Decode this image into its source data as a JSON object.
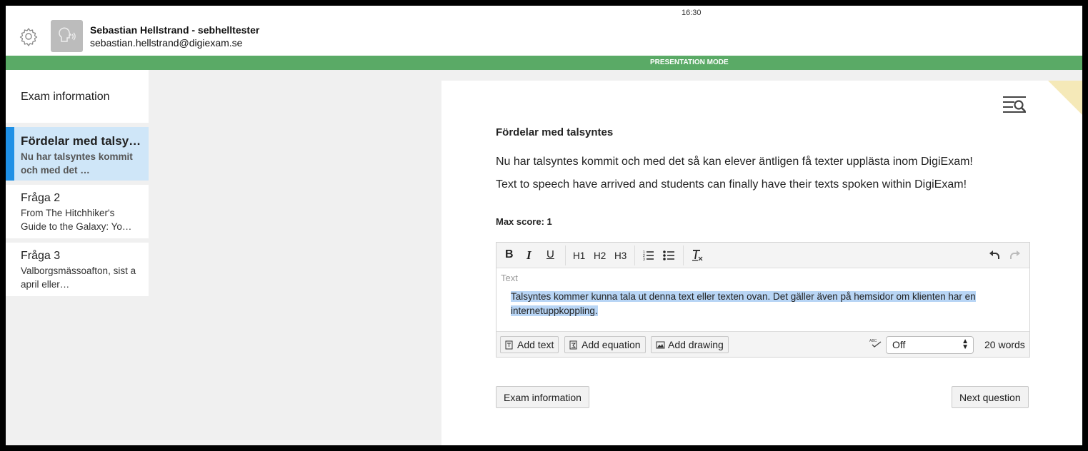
{
  "status": {
    "time": "16:30"
  },
  "user": {
    "name": "Sebastian Hellstrand - sebhelltester",
    "email": "sebastian.hellstrand@digiexam.se"
  },
  "mode_banner": "PRESENTATION MODE",
  "sidebar": {
    "info_label": "Exam information",
    "items": [
      {
        "title": "Fördelar med talsy…",
        "subtitle": "Nu har talsyntes kommit och med det …",
        "active": true
      },
      {
        "title": "Fråga 2",
        "subtitle": "From The Hitchhiker's Guide to the Galaxy: Yo…",
        "active": false
      },
      {
        "title": "Fråga 3",
        "subtitle": "Valborgsmässoafton, sist a april eller…",
        "active": false
      }
    ]
  },
  "question": {
    "title": "Fördelar med talsyntes",
    "line1": "Nu har talsyntes kommit och med det så kan elever äntligen få texter upplästa inom DigiExam!",
    "line2": "Text to speech have arrived and students can finally have their texts spoken within DigiExam!",
    "max_score": "Max score: 1"
  },
  "editor": {
    "toolbar": {
      "bold": "B",
      "italic": "I",
      "underline": "U",
      "h1": "H1",
      "h2": "H2",
      "h3": "H3"
    },
    "placeholder": "Text",
    "answer": "Talsyntes kommer kunna tala ut denna text eller texten ovan. Det gäller även på hemsidor om klienten har en internetuppkoppling.",
    "add_text": "Add text",
    "add_equation": "Add equation",
    "add_drawing": "Add drawing",
    "spellcheck_value": "Off",
    "word_count": "20 words"
  },
  "navigation": {
    "prev": "Exam information",
    "next": "Next question"
  },
  "colors": {
    "mode_banner": "#5aaa66",
    "active_item_bg": "#cfe6f8",
    "active_item_bar": "#1e90e6",
    "selection": "#b8d5f5"
  }
}
